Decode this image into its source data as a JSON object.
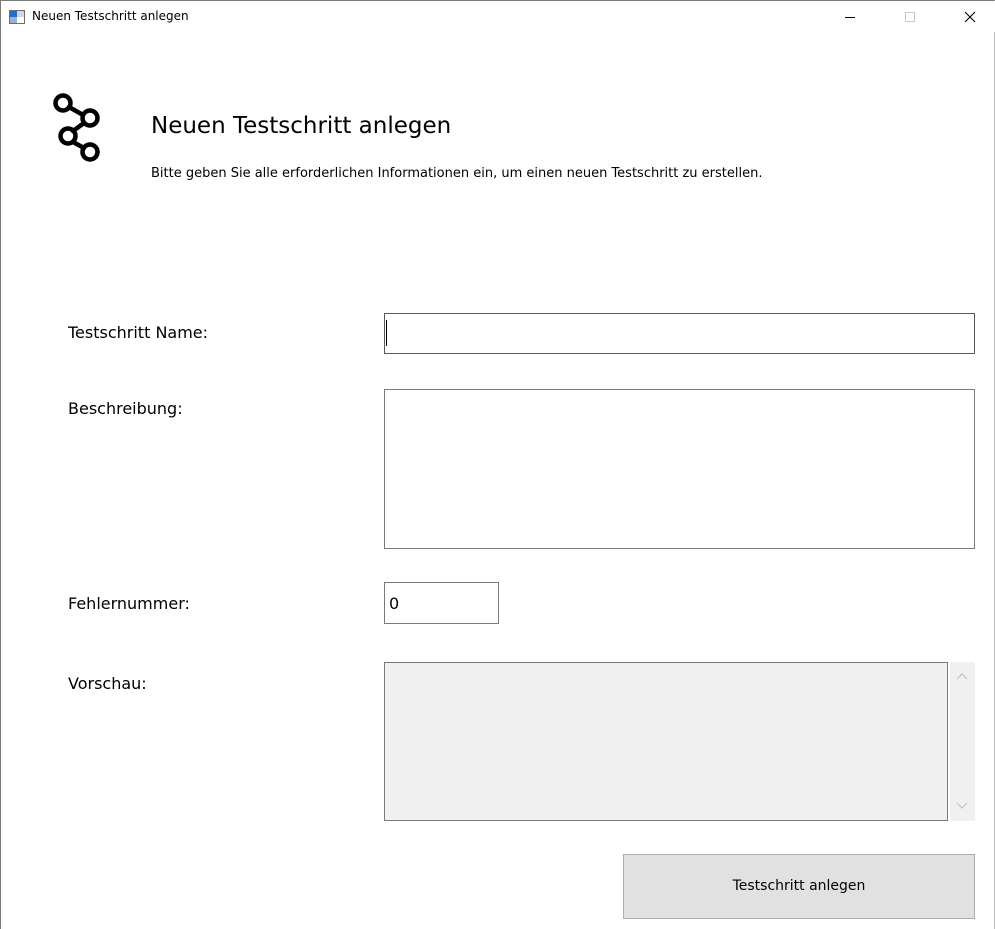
{
  "window": {
    "title": "Neuen Testschritt anlegen",
    "controls": {
      "minimize": "minimize-icon",
      "maximize": "maximize-icon",
      "close": "close-icon"
    }
  },
  "header": {
    "icon": "workflow-nodes-icon",
    "title": "Neuen Testschritt anlegen",
    "subtitle": "Bitte geben Sie alle erforderlichen Informationen ein, um einen neuen Testschritt zu erstellen."
  },
  "form": {
    "name": {
      "label": "Testschritt Name:",
      "value": ""
    },
    "description": {
      "label": "Beschreibung:",
      "value": ""
    },
    "error_number": {
      "label": "Fehlernummer:",
      "value": "0"
    },
    "preview": {
      "label": "Vorschau:",
      "value": ""
    }
  },
  "actions": {
    "submit_label": "Testschritt anlegen"
  },
  "colors": {
    "button_bg": "#e1e1e1",
    "preview_bg": "#f0f0f0",
    "border": "#7a7a7a"
  }
}
